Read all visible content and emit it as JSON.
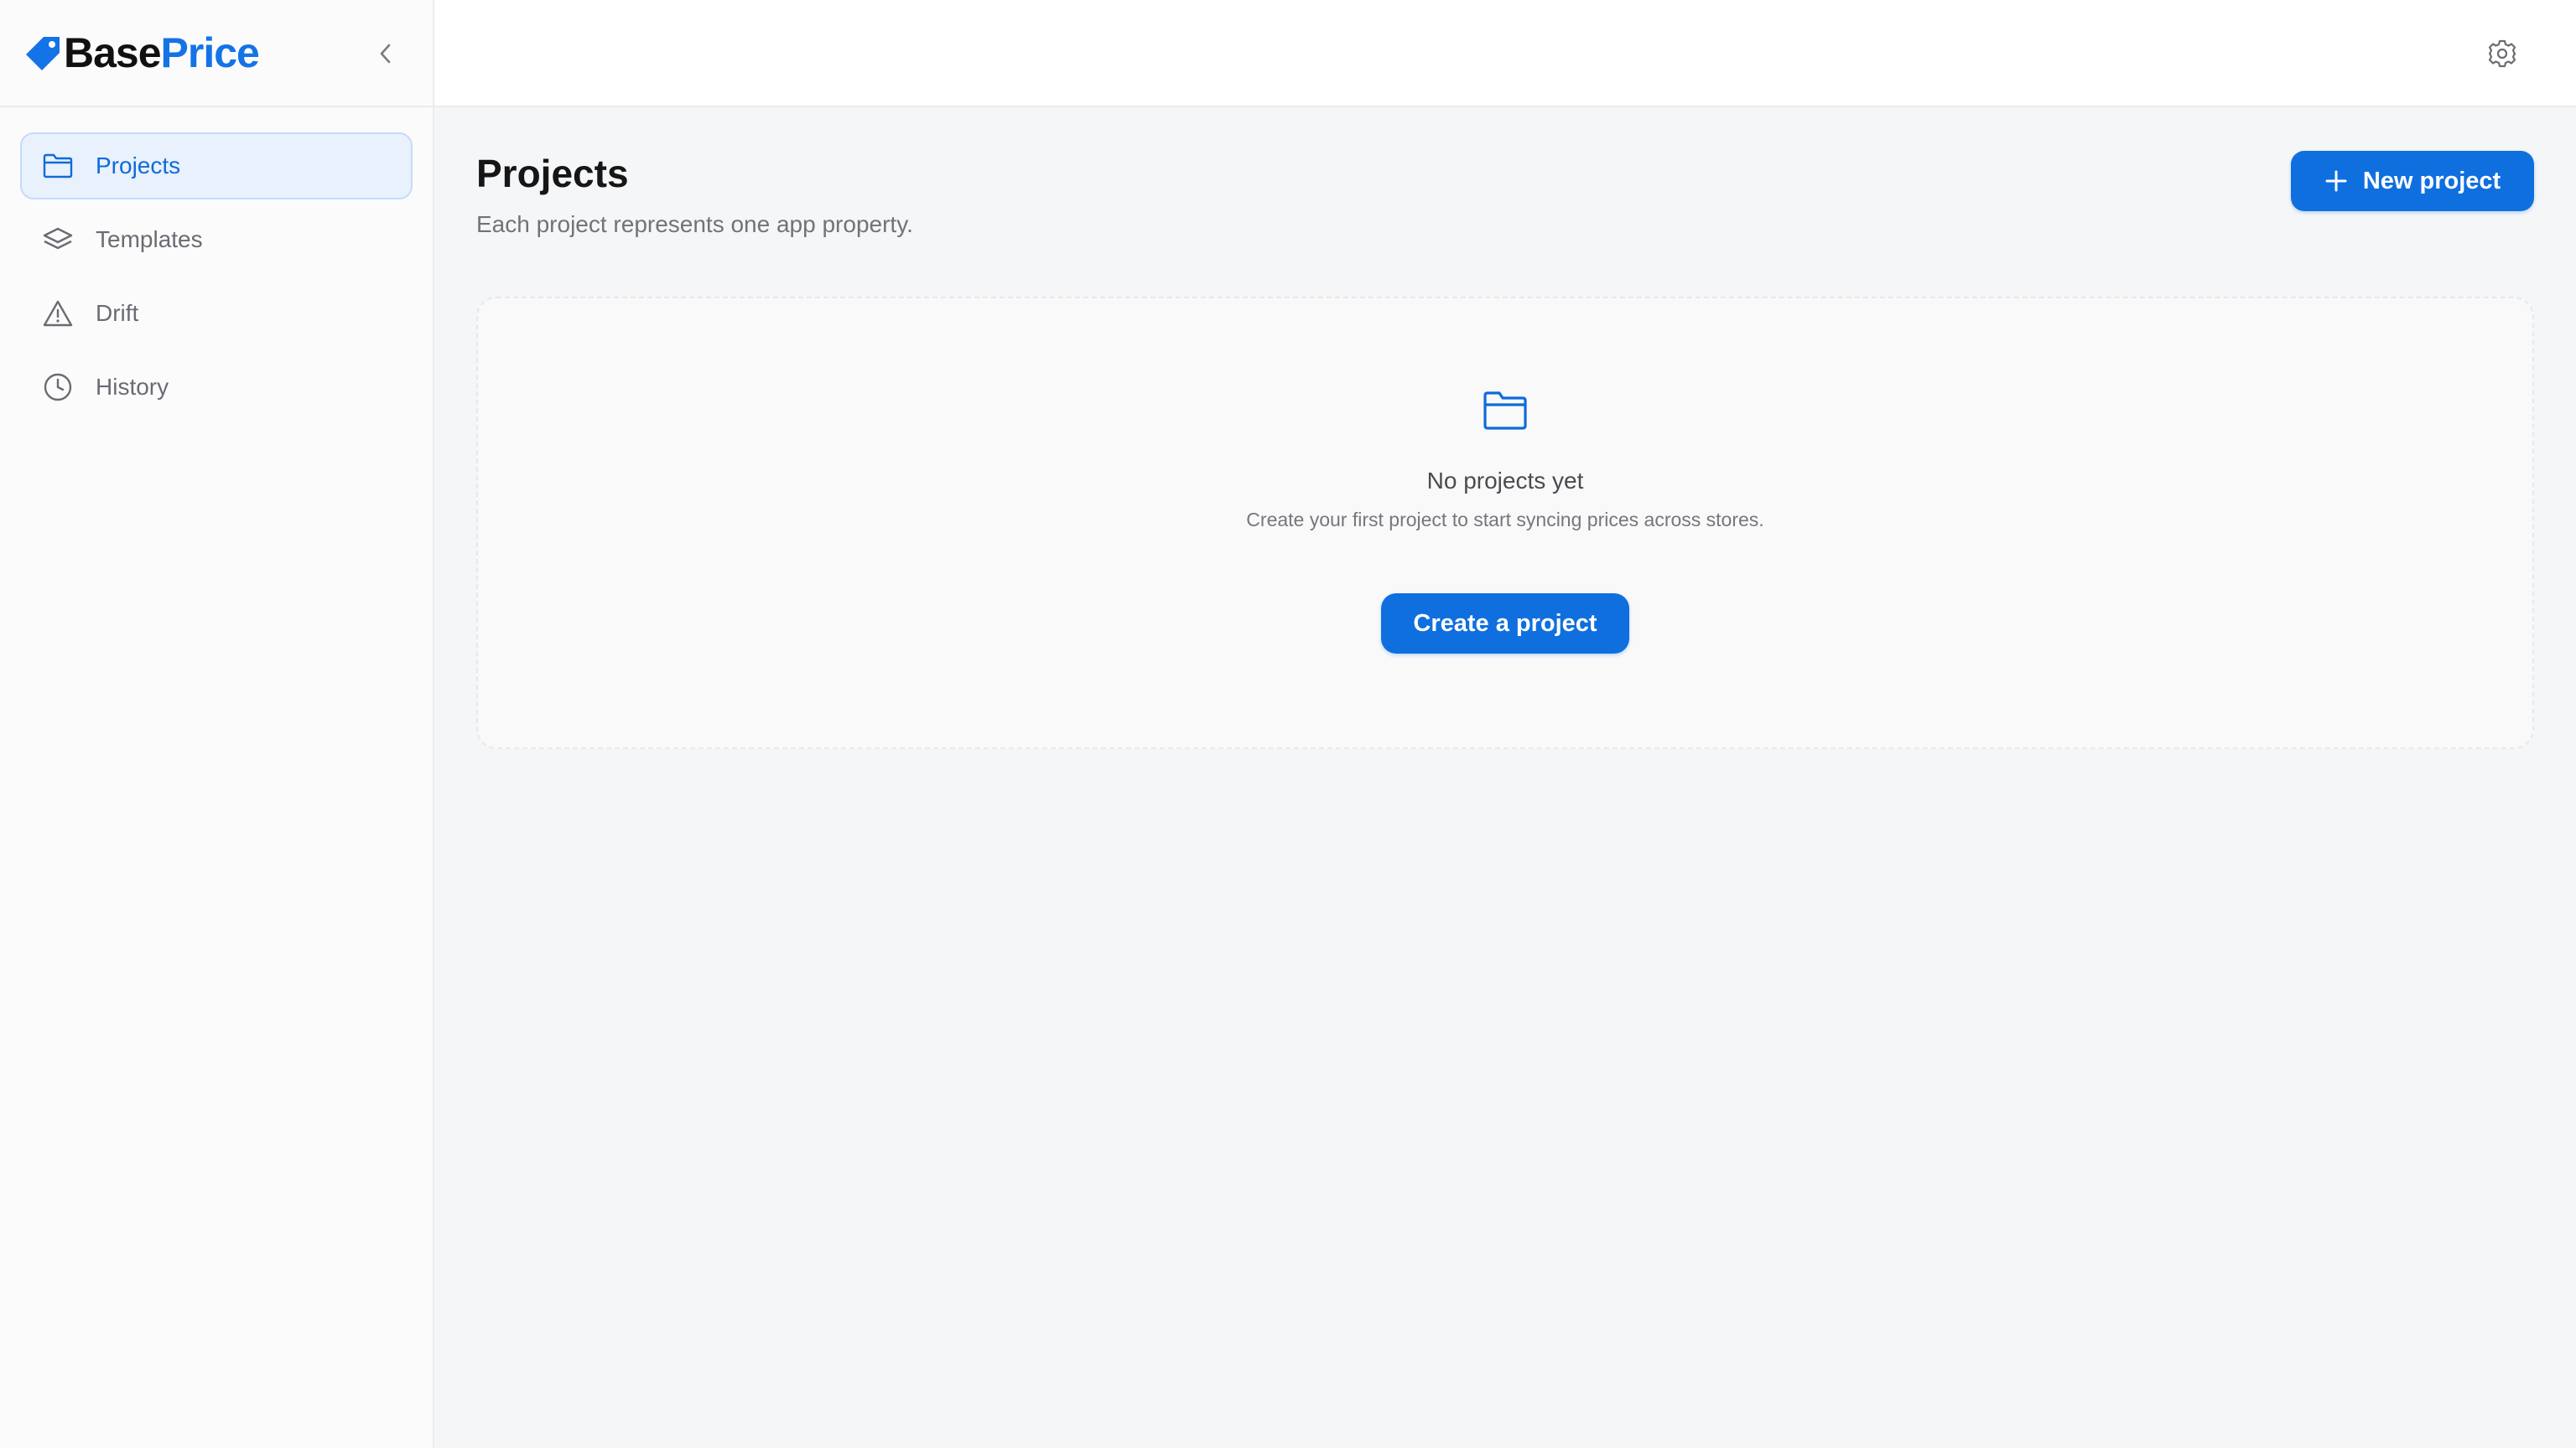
{
  "brand": {
    "name_part1": "Base",
    "name_part2": "Price",
    "accent_color": "#1473e6"
  },
  "sidebar": {
    "collapse_icon": "chevron-left-icon",
    "items": [
      {
        "label": "Projects",
        "icon": "folder-icon",
        "active": true
      },
      {
        "label": "Templates",
        "icon": "layers-icon",
        "active": false
      },
      {
        "label": "Drift",
        "icon": "warning-triangle-icon",
        "active": false
      },
      {
        "label": "History",
        "icon": "clock-icon",
        "active": false
      }
    ]
  },
  "topbar": {
    "settings_icon": "gear-icon"
  },
  "page": {
    "title": "Projects",
    "subtitle": "Each project represents one app property.",
    "new_button_label": "New project"
  },
  "empty_state": {
    "icon": "folder-icon",
    "title": "No projects yet",
    "description": "Create your first project to start syncing prices across stores.",
    "button_label": "Create a project"
  },
  "colors": {
    "primary": "#0f6fdf",
    "active_bg": "#e9f1fd"
  }
}
